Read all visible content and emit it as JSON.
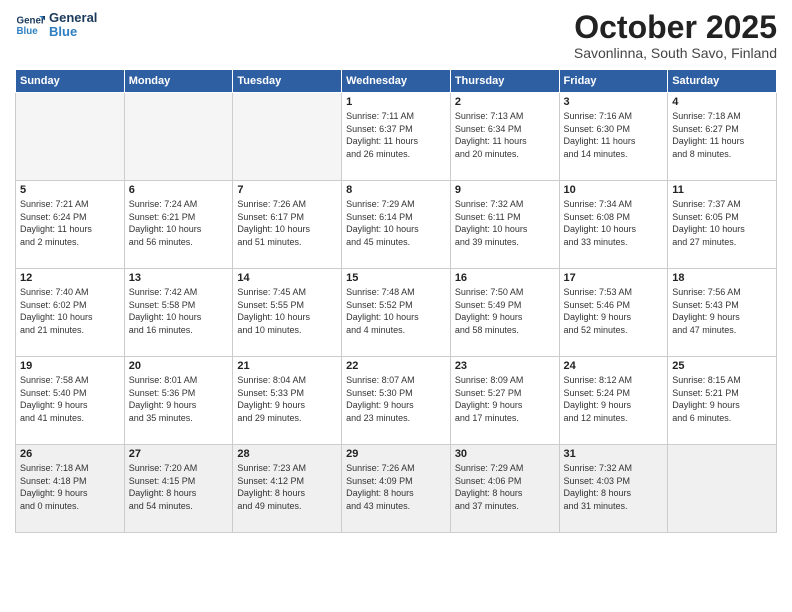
{
  "logo": {
    "line1": "General",
    "line2": "Blue"
  },
  "title": "October 2025",
  "subtitle": "Savonlinna, South Savo, Finland",
  "headers": [
    "Sunday",
    "Monday",
    "Tuesday",
    "Wednesday",
    "Thursday",
    "Friday",
    "Saturday"
  ],
  "weeks": [
    [
      {
        "day": "",
        "info": ""
      },
      {
        "day": "",
        "info": ""
      },
      {
        "day": "",
        "info": ""
      },
      {
        "day": "1",
        "info": "Sunrise: 7:11 AM\nSunset: 6:37 PM\nDaylight: 11 hours\nand 26 minutes."
      },
      {
        "day": "2",
        "info": "Sunrise: 7:13 AM\nSunset: 6:34 PM\nDaylight: 11 hours\nand 20 minutes."
      },
      {
        "day": "3",
        "info": "Sunrise: 7:16 AM\nSunset: 6:30 PM\nDaylight: 11 hours\nand 14 minutes."
      },
      {
        "day": "4",
        "info": "Sunrise: 7:18 AM\nSunset: 6:27 PM\nDaylight: 11 hours\nand 8 minutes."
      }
    ],
    [
      {
        "day": "5",
        "info": "Sunrise: 7:21 AM\nSunset: 6:24 PM\nDaylight: 11 hours\nand 2 minutes."
      },
      {
        "day": "6",
        "info": "Sunrise: 7:24 AM\nSunset: 6:21 PM\nDaylight: 10 hours\nand 56 minutes."
      },
      {
        "day": "7",
        "info": "Sunrise: 7:26 AM\nSunset: 6:17 PM\nDaylight: 10 hours\nand 51 minutes."
      },
      {
        "day": "8",
        "info": "Sunrise: 7:29 AM\nSunset: 6:14 PM\nDaylight: 10 hours\nand 45 minutes."
      },
      {
        "day": "9",
        "info": "Sunrise: 7:32 AM\nSunset: 6:11 PM\nDaylight: 10 hours\nand 39 minutes."
      },
      {
        "day": "10",
        "info": "Sunrise: 7:34 AM\nSunset: 6:08 PM\nDaylight: 10 hours\nand 33 minutes."
      },
      {
        "day": "11",
        "info": "Sunrise: 7:37 AM\nSunset: 6:05 PM\nDaylight: 10 hours\nand 27 minutes."
      }
    ],
    [
      {
        "day": "12",
        "info": "Sunrise: 7:40 AM\nSunset: 6:02 PM\nDaylight: 10 hours\nand 21 minutes."
      },
      {
        "day": "13",
        "info": "Sunrise: 7:42 AM\nSunset: 5:58 PM\nDaylight: 10 hours\nand 16 minutes."
      },
      {
        "day": "14",
        "info": "Sunrise: 7:45 AM\nSunset: 5:55 PM\nDaylight: 10 hours\nand 10 minutes."
      },
      {
        "day": "15",
        "info": "Sunrise: 7:48 AM\nSunset: 5:52 PM\nDaylight: 10 hours\nand 4 minutes."
      },
      {
        "day": "16",
        "info": "Sunrise: 7:50 AM\nSunset: 5:49 PM\nDaylight: 9 hours\nand 58 minutes."
      },
      {
        "day": "17",
        "info": "Sunrise: 7:53 AM\nSunset: 5:46 PM\nDaylight: 9 hours\nand 52 minutes."
      },
      {
        "day": "18",
        "info": "Sunrise: 7:56 AM\nSunset: 5:43 PM\nDaylight: 9 hours\nand 47 minutes."
      }
    ],
    [
      {
        "day": "19",
        "info": "Sunrise: 7:58 AM\nSunset: 5:40 PM\nDaylight: 9 hours\nand 41 minutes."
      },
      {
        "day": "20",
        "info": "Sunrise: 8:01 AM\nSunset: 5:36 PM\nDaylight: 9 hours\nand 35 minutes."
      },
      {
        "day": "21",
        "info": "Sunrise: 8:04 AM\nSunset: 5:33 PM\nDaylight: 9 hours\nand 29 minutes."
      },
      {
        "day": "22",
        "info": "Sunrise: 8:07 AM\nSunset: 5:30 PM\nDaylight: 9 hours\nand 23 minutes."
      },
      {
        "day": "23",
        "info": "Sunrise: 8:09 AM\nSunset: 5:27 PM\nDaylight: 9 hours\nand 17 minutes."
      },
      {
        "day": "24",
        "info": "Sunrise: 8:12 AM\nSunset: 5:24 PM\nDaylight: 9 hours\nand 12 minutes."
      },
      {
        "day": "25",
        "info": "Sunrise: 8:15 AM\nSunset: 5:21 PM\nDaylight: 9 hours\nand 6 minutes."
      }
    ],
    [
      {
        "day": "26",
        "info": "Sunrise: 7:18 AM\nSunset: 4:18 PM\nDaylight: 9 hours\nand 0 minutes."
      },
      {
        "day": "27",
        "info": "Sunrise: 7:20 AM\nSunset: 4:15 PM\nDaylight: 8 hours\nand 54 minutes."
      },
      {
        "day": "28",
        "info": "Sunrise: 7:23 AM\nSunset: 4:12 PM\nDaylight: 8 hours\nand 49 minutes."
      },
      {
        "day": "29",
        "info": "Sunrise: 7:26 AM\nSunset: 4:09 PM\nDaylight: 8 hours\nand 43 minutes."
      },
      {
        "day": "30",
        "info": "Sunrise: 7:29 AM\nSunset: 4:06 PM\nDaylight: 8 hours\nand 37 minutes."
      },
      {
        "day": "31",
        "info": "Sunrise: 7:32 AM\nSunset: 4:03 PM\nDaylight: 8 hours\nand 31 minutes."
      },
      {
        "day": "",
        "info": ""
      }
    ]
  ]
}
